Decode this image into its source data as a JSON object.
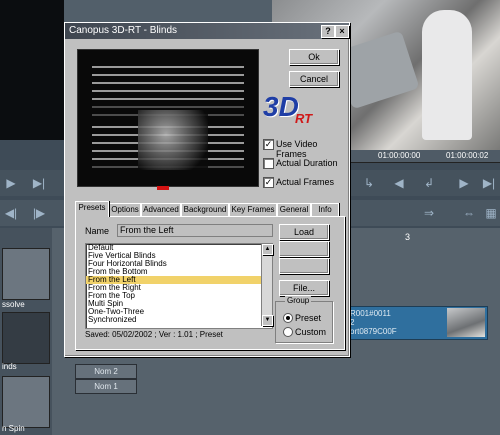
{
  "window": {
    "title": "Canopus 3D-RT - Blinds",
    "help_label": "?",
    "close_label": "×"
  },
  "buttons": {
    "ok": "Ok",
    "cancel": "Cancel",
    "load": "Load",
    "save": "",
    "delete": "",
    "file": "File..."
  },
  "logo": {
    "main": "3D",
    "sub": "RT"
  },
  "options": {
    "use_video_frames": {
      "label": "Use Video Frames",
      "checked": true
    },
    "actual_duration": {
      "label": "Actual Duration",
      "checked": false
    },
    "actual_frames": {
      "label": "Actual Frames",
      "checked": true
    }
  },
  "tabs": [
    "Presets",
    "Options",
    "Advanced",
    "Background",
    "Key Frames",
    "General",
    "Info"
  ],
  "active_tab": "Presets",
  "preset": {
    "name_label": "Name",
    "name_value": "From the Left",
    "items": [
      "Default",
      "Five Vertical Blinds",
      "Four Horizontal Blinds",
      "From the Bottom",
      "From the Left",
      "From the Right",
      "From the Top",
      "Multi Spin",
      "One-Two-Three",
      "Synchronized"
    ],
    "selected_index": 4,
    "status": "Saved: 05/02/2002 ; Ver : 1.01 ; Preset"
  },
  "group": {
    "label": "Group",
    "options": [
      "Preset",
      "Custom"
    ],
    "selected": "Preset"
  },
  "timeline": {
    "timecode_1": "01:00:00:00",
    "timecode_2": "01:00:00:02",
    "track_number": "3",
    "track_rows": [
      "Nom 2",
      "Nom 1"
    ],
    "clip_lines": [
      "R001#0011",
      "2",
      "ort0879C00F"
    ],
    "bin_labels": [
      "ssolve",
      "inds",
      "n Spin"
    ]
  },
  "colors": {
    "title_bar": "#4f5761",
    "selection": "#f1d26a",
    "logo_blue": "#1f3ea6",
    "logo_red": "#d01818"
  }
}
